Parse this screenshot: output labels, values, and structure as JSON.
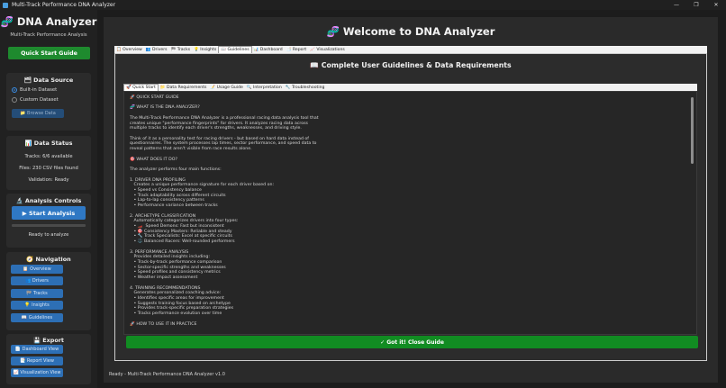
{
  "window": {
    "title": "Multi-Track Performance DNA Analyzer",
    "controls": [
      "—",
      "❐",
      "✕"
    ]
  },
  "sidebar": {
    "app_title": "🧬 DNA Analyzer",
    "app_subtitle": "Multi-Track Performance Analysis",
    "quick_start_label": "Quick Start Guide",
    "data_source": {
      "title": "🗂 Data Source",
      "options": [
        "Built-in Dataset",
        "Custom Dataset"
      ],
      "selected": "Built-in Dataset",
      "browse_label": "📁 Browse Data"
    },
    "data_status": {
      "title": "📊 Data Status",
      "tracks": "Tracks: 6/6 available",
      "files": "Files: 230 CSV files found",
      "validation": "Validation: Ready"
    },
    "analysis_controls": {
      "title": "🔬 Analysis Controls",
      "start_label": "▶ Start Analysis",
      "progress": 0,
      "status": "Ready to analyze"
    },
    "navigation": {
      "title": "🧭 Navigation",
      "items": [
        "📋 Overview",
        "👥 Drivers",
        "🏁 Tracks",
        "💡 Insights",
        "📖 Guidelines"
      ]
    },
    "export": {
      "title": "💾 Export",
      "items": [
        "📄 Dashboard View",
        "📑 Report View",
        "📈 Visualization View"
      ]
    }
  },
  "main": {
    "title": "🧬 Welcome to DNA Analyzer",
    "tabs": [
      "📋 Overview",
      "👥 Drivers",
      "🏁 Tracks",
      "💡 Insights",
      "📖 Guidelines",
      "📊 Dashboard",
      "📑 Report",
      "📈 Visualizations"
    ],
    "active_tab": "📖 Guidelines",
    "guide_title": "📖 Complete User Guidelines & Data Requirements",
    "inner_tabs": [
      "🚀 Quick Start",
      "📁 Data Requirements",
      "📝 Usage Guide",
      "🔍 Interpretation",
      "🔧 Troubleshooting"
    ],
    "active_inner_tab": "🚀 Quick Start",
    "guide_text": [
      "🚀 QUICK START GUIDE",
      "",
      "🧬 WHAT IS THE DNA ANALYZER?",
      "",
      "The Multi-Track Performance DNA Analyzer is a professional racing data analysis tool that",
      "creates unique \"performance fingerprints\" for drivers. It analyzes racing data across",
      "multiple tracks to identify each driver's strengths, weaknesses, and driving style.",
      "",
      "Think of it as a personality test for racing drivers - but based on hard data instead of",
      "questionnaires. The system processes lap times, sector performance, and speed data to",
      "reveal patterns that aren't visible from race results alone.",
      "",
      "🎯 WHAT DOES IT DO?",
      "",
      "The analyzer performs four main functions:",
      "",
      "1. DRIVER DNA PROFILING",
      "   Creates a unique performance signature for each driver based on:",
      "   • Speed vs Consistency balance",
      "   • Track adaptability across different circuits",
      "   • Lap-to-lap consistency patterns",
      "   • Performance variance between tracks",
      "",
      "2. ARCHETYPE CLASSIFICATION",
      "   Automatically categorizes drivers into four types:",
      "   • 🏎️  Speed Demons: Fast but inconsistent",
      "   • 🎯 Consistency Masters: Reliable and steady",
      "   • 🔧 Track Specialists: Excel at specific circuits",
      "   • ⚖️ Balanced Racers: Well-rounded performers",
      "",
      "3. PERFORMANCE ANALYSIS",
      "   Provides detailed insights including:",
      "   • Track-by-track performance comparison",
      "   • Sector-specific strengths and weaknesses",
      "   • Speed profiles and consistency metrics",
      "   • Weather impact assessment",
      "",
      "4. TRAINING RECOMMENDATIONS",
      "   Generates personalized coaching advice:",
      "   • Identifies specific areas for improvement",
      "   • Suggests training focus based on archetype",
      "   • Provides track-specific preparation strategies",
      "   • Tracks performance evolution over time",
      "",
      "🚀 HOW TO USE IT IN PRACTICE"
    ],
    "got_it_label": "✓ Got it! Close Guide",
    "status_bar": "Ready - Multi-Track Performance DNA Analyzer v1.0"
  }
}
